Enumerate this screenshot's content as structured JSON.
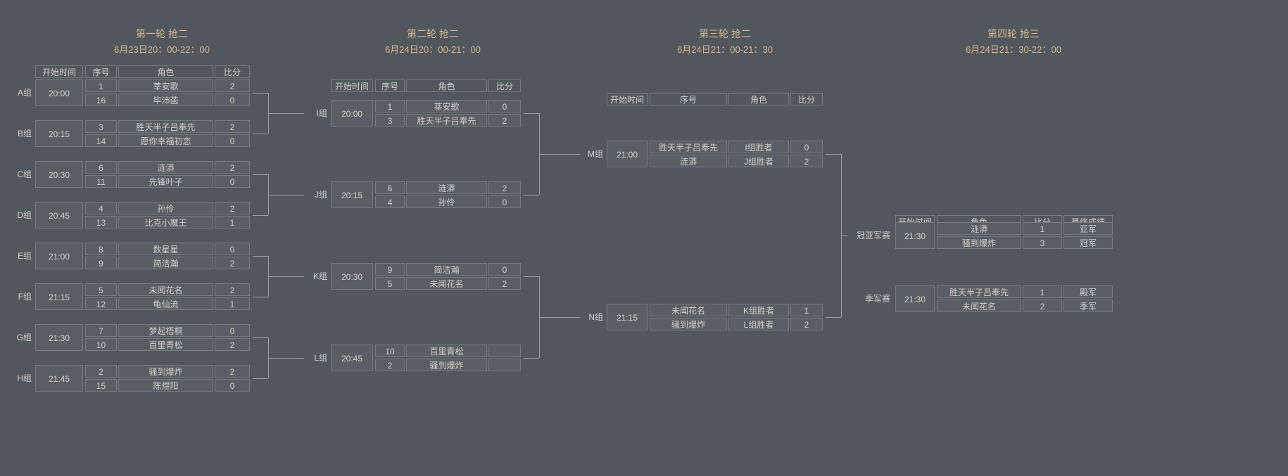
{
  "rounds": [
    {
      "title": "第一轮 抢二",
      "time": "6月23日20：00-22：00"
    },
    {
      "title": "第二轮 抢二",
      "time": "6月24日20：00-21：00"
    },
    {
      "title": "第三轮 抢二",
      "time": "6月24日21：00-21：30"
    },
    {
      "title": "第四轮 抢三",
      "time": "6月24日21：30-22：00"
    }
  ],
  "headers": {
    "start": "开始时间",
    "seed": "序号",
    "role": "角色",
    "score": "比分",
    "result": "最终成绩"
  },
  "r1_groups": [
    {
      "label": "A组",
      "start": "20:00",
      "rows": [
        {
          "seed": "1",
          "role": "莘安歌",
          "score": "2"
        },
        {
          "seed": "16",
          "role": "毕沛菡",
          "score": "0"
        }
      ]
    },
    {
      "label": "B组",
      "start": "20:15",
      "rows": [
        {
          "seed": "3",
          "role": "胜天半子吕奉先",
          "score": "2"
        },
        {
          "seed": "14",
          "role": "愿你幸福初恋",
          "score": "0"
        }
      ]
    },
    {
      "label": "C组",
      "start": "20:30",
      "rows": [
        {
          "seed": "6",
          "role": "涟漭",
          "score": "2"
        },
        {
          "seed": "11",
          "role": "先锋叶子",
          "score": "0"
        }
      ]
    },
    {
      "label": "D组",
      "start": "20:45",
      "rows": [
        {
          "seed": "4",
          "role": "孙伶",
          "score": "2"
        },
        {
          "seed": "13",
          "role": "比克小魔王",
          "score": "1"
        }
      ]
    },
    {
      "label": "E组",
      "start": "21:00",
      "rows": [
        {
          "seed": "8",
          "role": "数星星",
          "score": "0"
        },
        {
          "seed": "9",
          "role": "简洁瀚",
          "score": "2"
        }
      ]
    },
    {
      "label": "F组",
      "start": "21:15",
      "rows": [
        {
          "seed": "5",
          "role": "未闻花名",
          "score": "2"
        },
        {
          "seed": "12",
          "role": "龟仙流",
          "score": "1"
        }
      ]
    },
    {
      "label": "G组",
      "start": "21:30",
      "rows": [
        {
          "seed": "7",
          "role": "梦起梧桐",
          "score": "0"
        },
        {
          "seed": "10",
          "role": "百里青松",
          "score": "2"
        }
      ]
    },
    {
      "label": "H组",
      "start": "21:45",
      "rows": [
        {
          "seed": "2",
          "role": "骚到爆炸",
          "score": "2"
        },
        {
          "seed": "15",
          "role": "陈煜阳",
          "score": "0"
        }
      ]
    }
  ],
  "r2_groups": [
    {
      "label": "I组",
      "start": "20:00",
      "rows": [
        {
          "seed": "1",
          "role": "莘安歌",
          "score": "0"
        },
        {
          "seed": "3",
          "role": "胜天半子吕奉先",
          "score": "2"
        }
      ]
    },
    {
      "label": "J组",
      "start": "20:15",
      "rows": [
        {
          "seed": "6",
          "role": "涟漭",
          "score": "2"
        },
        {
          "seed": "4",
          "role": "孙伶",
          "score": "0"
        }
      ]
    },
    {
      "label": "K组",
      "start": "20:30",
      "rows": [
        {
          "seed": "9",
          "role": "简洁瀚",
          "score": "0"
        },
        {
          "seed": "5",
          "role": "未闻花名",
          "score": "2"
        }
      ]
    },
    {
      "label": "L组",
      "start": "20:45",
      "rows": [
        {
          "seed": "10",
          "role": "百里青松",
          "score": ""
        },
        {
          "seed": "2",
          "role": "骚到爆炸",
          "score": ""
        }
      ]
    }
  ],
  "r3_groups": [
    {
      "label": "M组",
      "start": "21:00",
      "rows": [
        {
          "seed": "胜天半子吕奉先",
          "role": "I组胜者",
          "score": "0"
        },
        {
          "seed": "涟漭",
          "role": "J组胜者",
          "score": "2"
        }
      ]
    },
    {
      "label": "N组",
      "start": "21:15",
      "rows": [
        {
          "seed": "未闻花名",
          "role": "K组胜者",
          "score": "1"
        },
        {
          "seed": "骚到爆炸",
          "role": "L组胜者",
          "score": "2"
        }
      ]
    }
  ],
  "r4_groups": [
    {
      "label": "冠亚军赛",
      "start": "21:30",
      "rows": [
        {
          "role": "涟漭",
          "score": "1",
          "result": "亚军"
        },
        {
          "role": "骚到爆炸",
          "score": "3",
          "result": "冠军"
        }
      ]
    },
    {
      "label": "季军赛",
      "start": "21:30",
      "rows": [
        {
          "role": "胜天半子吕奉先",
          "score": "1",
          "result": "殿军"
        },
        {
          "role": "未闻花名",
          "score": "2",
          "result": "季军"
        }
      ]
    }
  ]
}
